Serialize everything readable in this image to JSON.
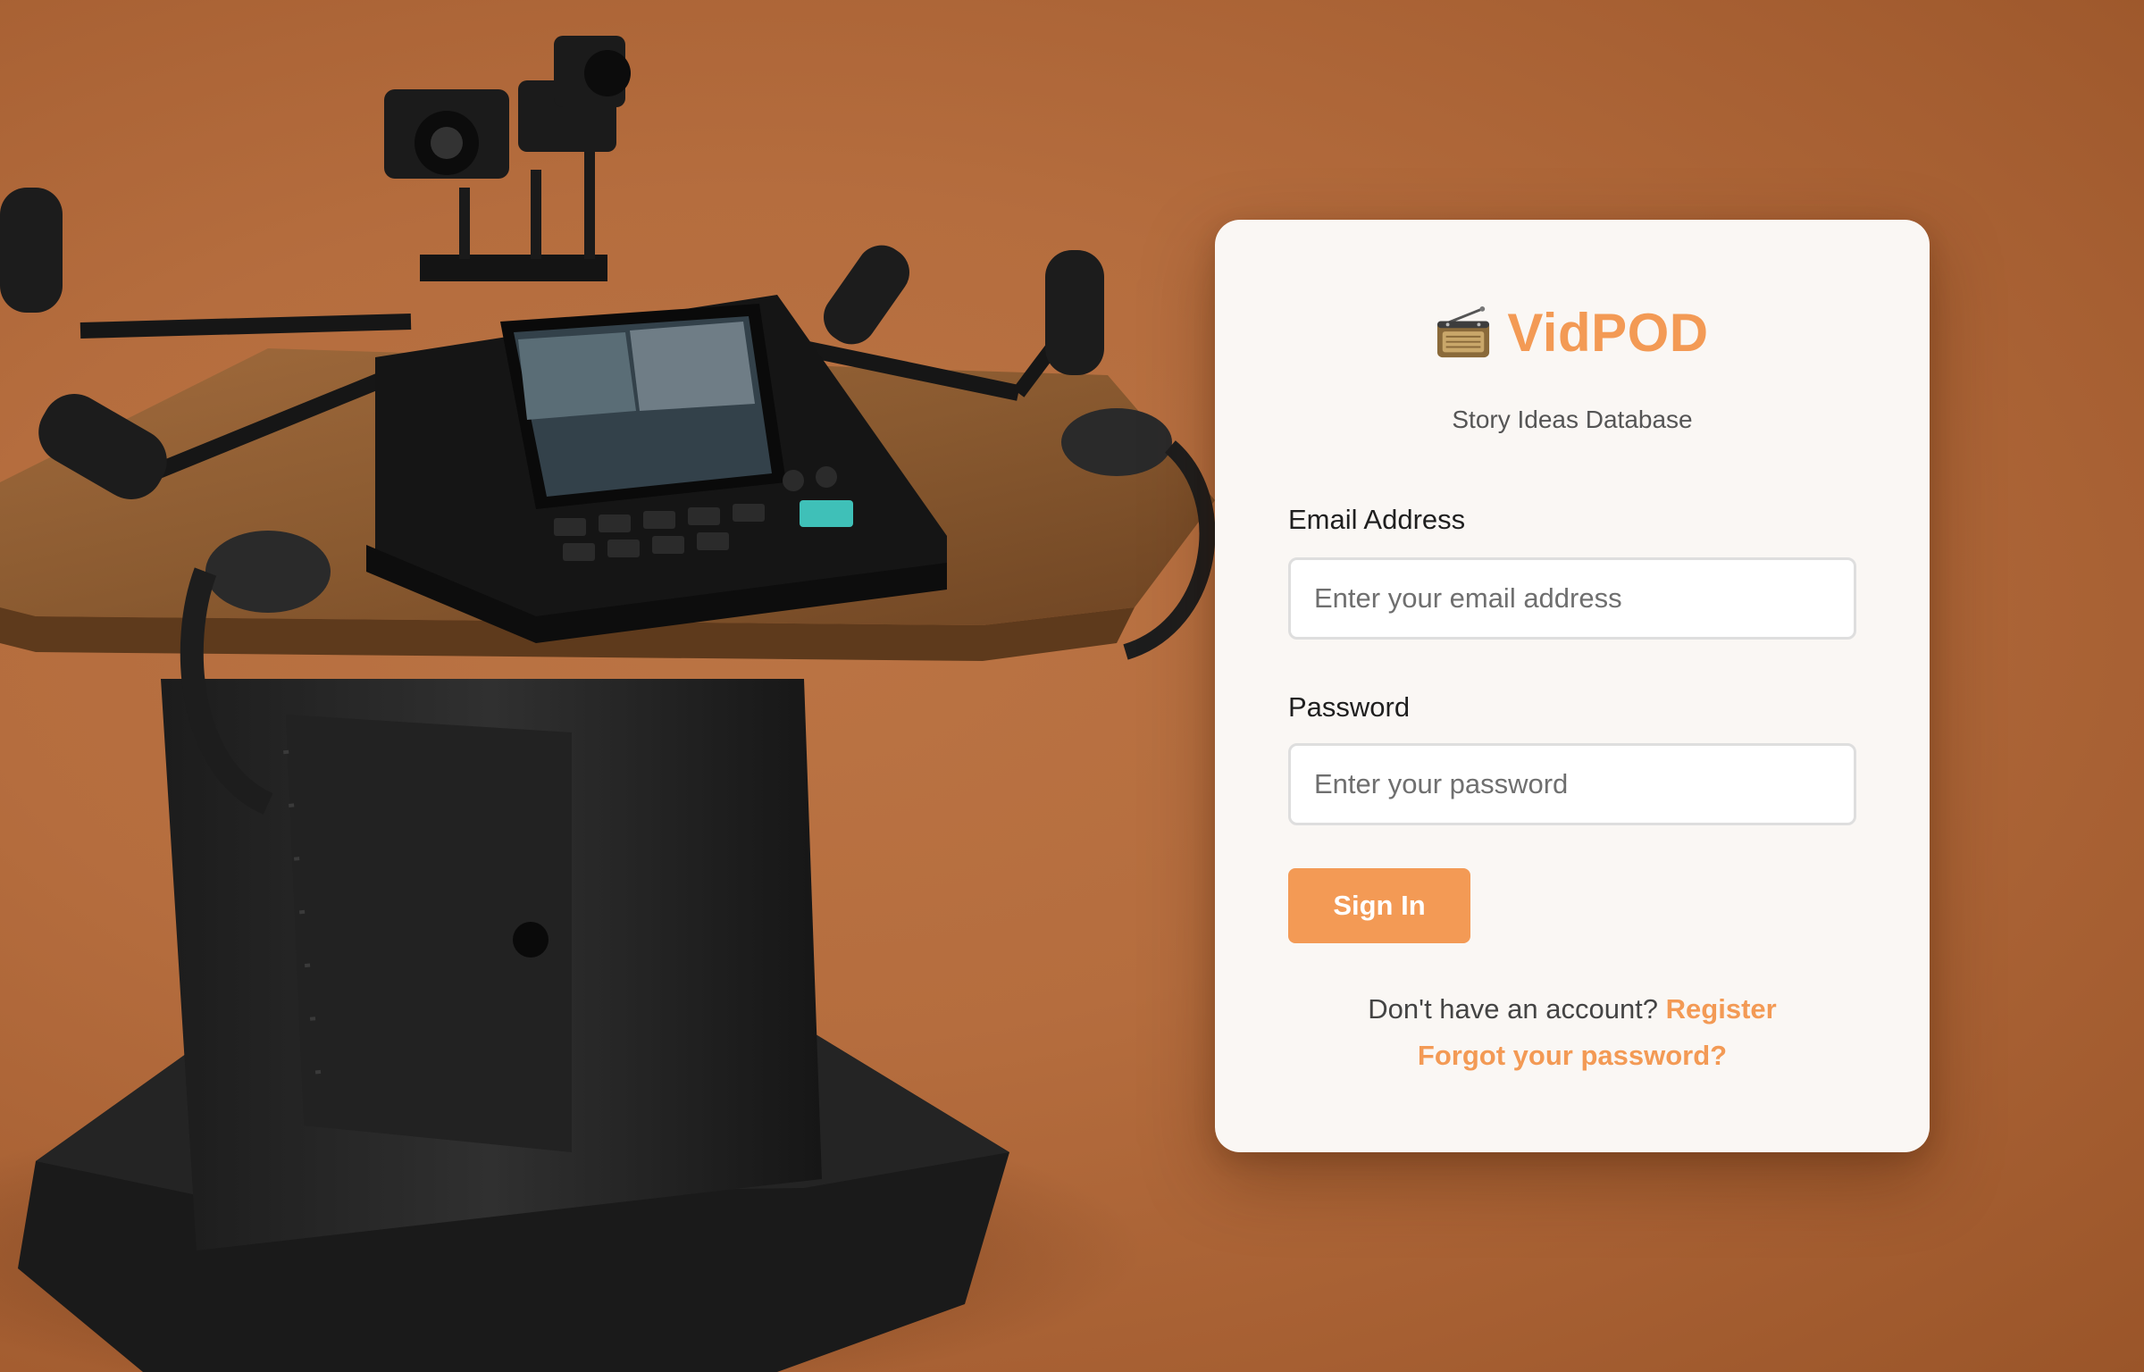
{
  "app": {
    "name": "VidPOD",
    "subtitle": "Story Ideas Database",
    "icon": "radio-icon",
    "accent_color": "#f39a55"
  },
  "form": {
    "email_label": "Email Address",
    "email_placeholder": "Enter your email address",
    "email_value": "",
    "password_label": "Password",
    "password_placeholder": "Enter your password",
    "password_value": "",
    "submit_label": "Sign In"
  },
  "footer": {
    "register_prompt": "Don't have an account?",
    "register_link": "Register",
    "forgot_link": "Forgot your password?"
  },
  "background": {
    "image": "podcast-studio-table",
    "color": "#b56d3e"
  }
}
